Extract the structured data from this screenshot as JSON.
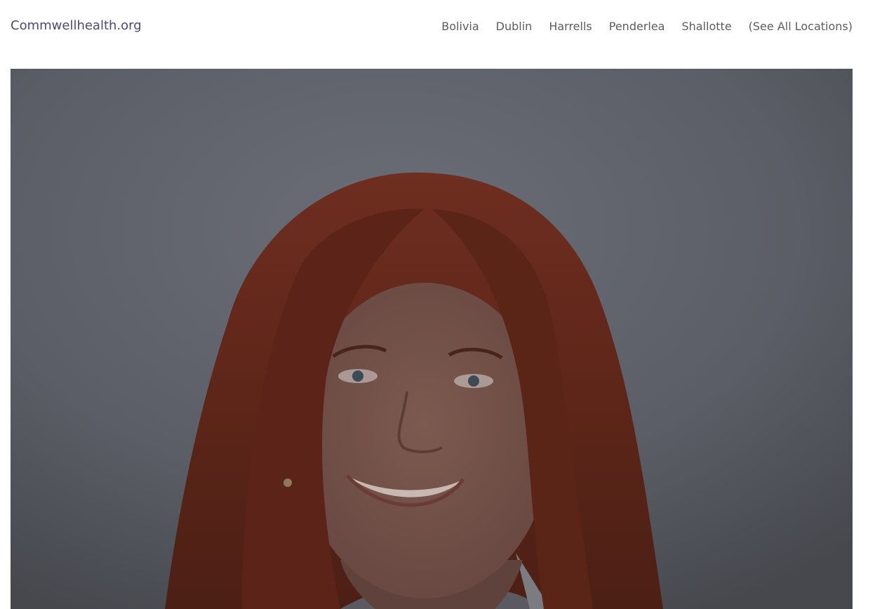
{
  "header": {
    "site_name": "Commwellhealth.org",
    "nav": [
      "Bolivia",
      "Dublin",
      "Harrells",
      "Penderlea",
      "Shallotte",
      "(See All Locations)"
    ]
  },
  "photo": {
    "subject": "portrait photo of a smiling woman with red hair"
  },
  "colors": {
    "brand_text": "#4f4775",
    "nav_text": "#5d5d5d"
  }
}
